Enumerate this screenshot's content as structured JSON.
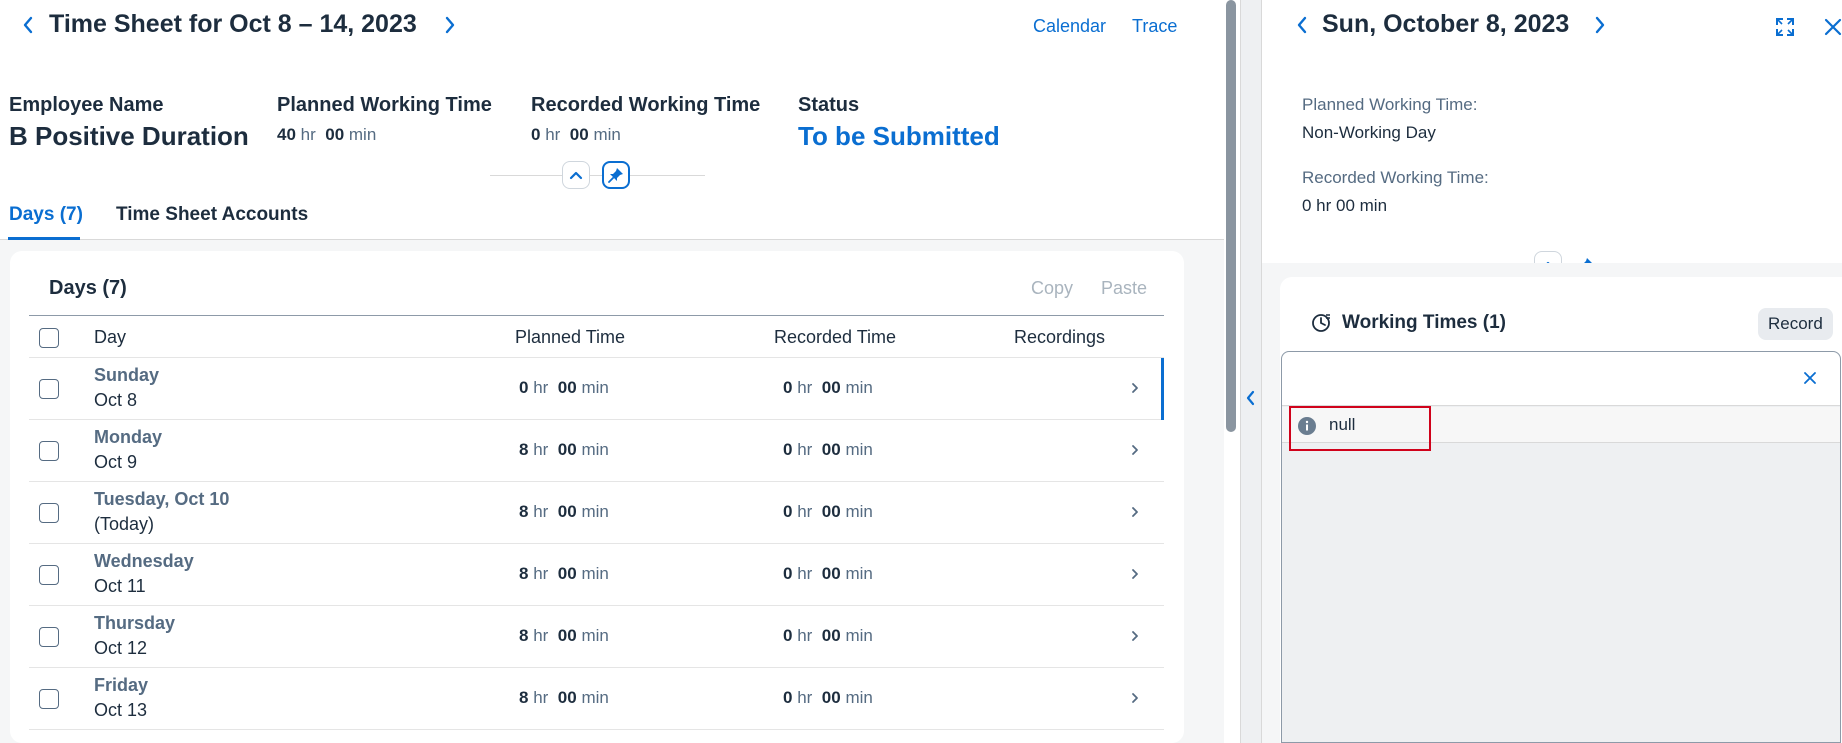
{
  "timesheet": {
    "title": "Time Sheet for Oct 8 – 14, 2023",
    "links": {
      "calendar": "Calendar",
      "trace": "Trace"
    },
    "employee": {
      "label": "Employee Name",
      "value": "B Positive Duration"
    },
    "planned": {
      "label": "Planned Working Time",
      "hr": "40",
      "min": "00"
    },
    "recorded": {
      "label": "Recorded Working Time",
      "hr": "0",
      "min": "00"
    },
    "status": {
      "label": "Status",
      "value": "To be Submitted"
    },
    "units": {
      "hr": "hr",
      "min": "min"
    },
    "tabs": [
      {
        "label": "Days (7)",
        "active": true
      },
      {
        "label": "Time Sheet Accounts",
        "active": false
      }
    ],
    "days_section": {
      "title": "Days (7)",
      "copy_label": "Copy",
      "paste_label": "Paste",
      "columns": {
        "day": "Day",
        "planned": "Planned Time",
        "recorded": "Recorded Time",
        "recordings": "Recordings"
      },
      "rows": [
        {
          "name": "Sunday",
          "date": "Oct 8",
          "planned_hr": "0",
          "planned_min": "00",
          "recorded_hr": "0",
          "recorded_min": "00",
          "selected": true
        },
        {
          "name": "Monday",
          "date": "Oct 9",
          "planned_hr": "8",
          "planned_min": "00",
          "recorded_hr": "0",
          "recorded_min": "00",
          "selected": false
        },
        {
          "name": "Tuesday, Oct 10",
          "date": "(Today)",
          "planned_hr": "8",
          "planned_min": "00",
          "recorded_hr": "0",
          "recorded_min": "00",
          "selected": false
        },
        {
          "name": "Wednesday",
          "date": "Oct 11",
          "planned_hr": "8",
          "planned_min": "00",
          "recorded_hr": "0",
          "recorded_min": "00",
          "selected": false
        },
        {
          "name": "Thursday",
          "date": "Oct 12",
          "planned_hr": "8",
          "planned_min": "00",
          "recorded_hr": "0",
          "recorded_min": "00",
          "selected": false
        },
        {
          "name": "Friday",
          "date": "Oct 13",
          "planned_hr": "8",
          "planned_min": "00",
          "recorded_hr": "0",
          "recorded_min": "00",
          "selected": false
        }
      ]
    }
  },
  "detail": {
    "title": "Sun, October 8, 2023",
    "planned_label": "Planned Working Time:",
    "planned_value": "Non-Working Day",
    "recorded_label": "Recorded Working Time:",
    "recorded_value": "0 hr 00 min",
    "working_times_title": "Working Times (1)",
    "record_label": "Record",
    "message": "null"
  },
  "icons": {
    "nav_prev": "chevron-left-icon",
    "nav_next": "chevron-right-icon",
    "collapse": "chevron-up-icon",
    "pin": "pin-icon",
    "expand": "full-screen-icon",
    "close": "close-icon",
    "working_times": "time-entry-icon",
    "message": "information-icon"
  },
  "colors": {
    "brand": "#0a6ed1",
    "text": "#1d2d3e",
    "muted": "#556b82",
    "error_highlight": "#d0021b"
  }
}
